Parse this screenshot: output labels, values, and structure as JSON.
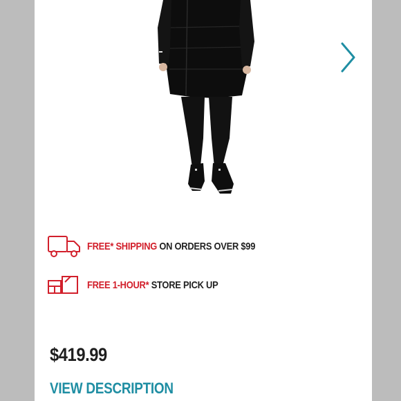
{
  "gallery": {
    "image_alt": "Woman wearing a long black hooded down parka with black leggings and black sneakers",
    "next_icon": "chevron-right-icon",
    "accent_color": "#1f8ea3"
  },
  "promos": {
    "shipping": {
      "icon": "delivery-truck-icon",
      "highlight": "FREE* SHIPPING",
      "rest": " ON ORDERS OVER $99"
    },
    "pickup": {
      "icon": "store-pickup-icon",
      "highlight": "FREE 1-HOUR*",
      "rest": " STORE PICK UP"
    },
    "accent_color": "#d21f2b"
  },
  "product": {
    "price": "$419.99",
    "view_description_label": "VIEW DESCRIPTION"
  }
}
